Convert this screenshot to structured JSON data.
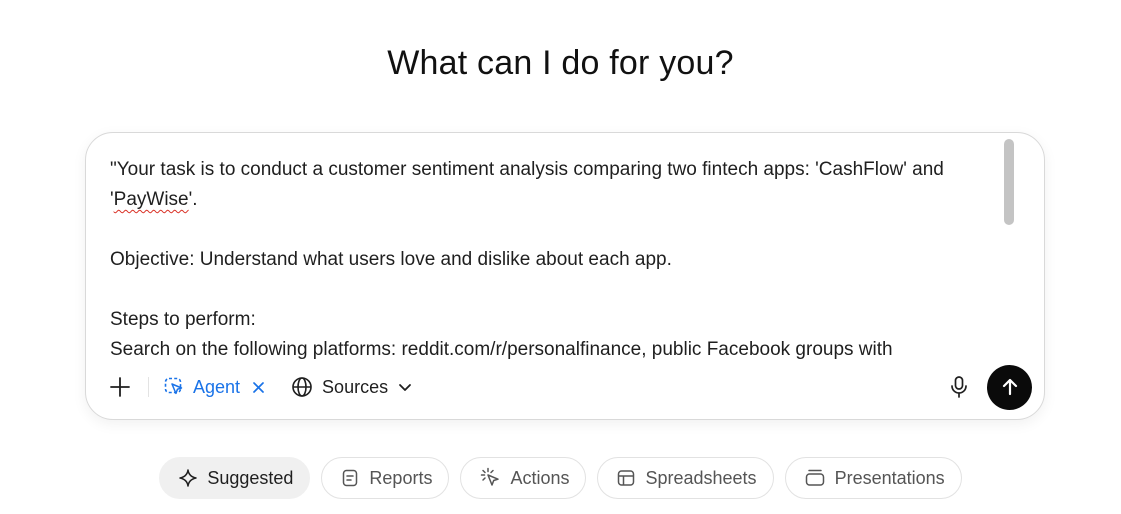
{
  "heading": "What can I do for you?",
  "composer": {
    "prompt_lines": [
      "\"Your task is to conduct a customer sentiment analysis comparing two fintech apps: 'CashFlow' and",
      "'PayWise'.",
      "Objective: Understand what users love and dislike about each app.",
      "Steps to perform:",
      "Search on the following platforms: reddit.com/r/personalfinance, public Facebook groups with"
    ],
    "misspelled_word": "PayWise",
    "agent_label": "Agent",
    "sources_label": "Sources"
  },
  "suggestions": [
    {
      "label": "Suggested",
      "icon": "sparkle-icon",
      "active": true
    },
    {
      "label": "Reports",
      "icon": "document-icon",
      "active": false
    },
    {
      "label": "Actions",
      "icon": "cursor-click-icon",
      "active": false
    },
    {
      "label": "Spreadsheets",
      "icon": "table-icon",
      "active": false
    },
    {
      "label": "Presentations",
      "icon": "presentation-icon",
      "active": false
    }
  ],
  "colors": {
    "accent": "#1a73e8",
    "send_button": "#0a0a0a",
    "active_chip": "#f0f0f0"
  }
}
